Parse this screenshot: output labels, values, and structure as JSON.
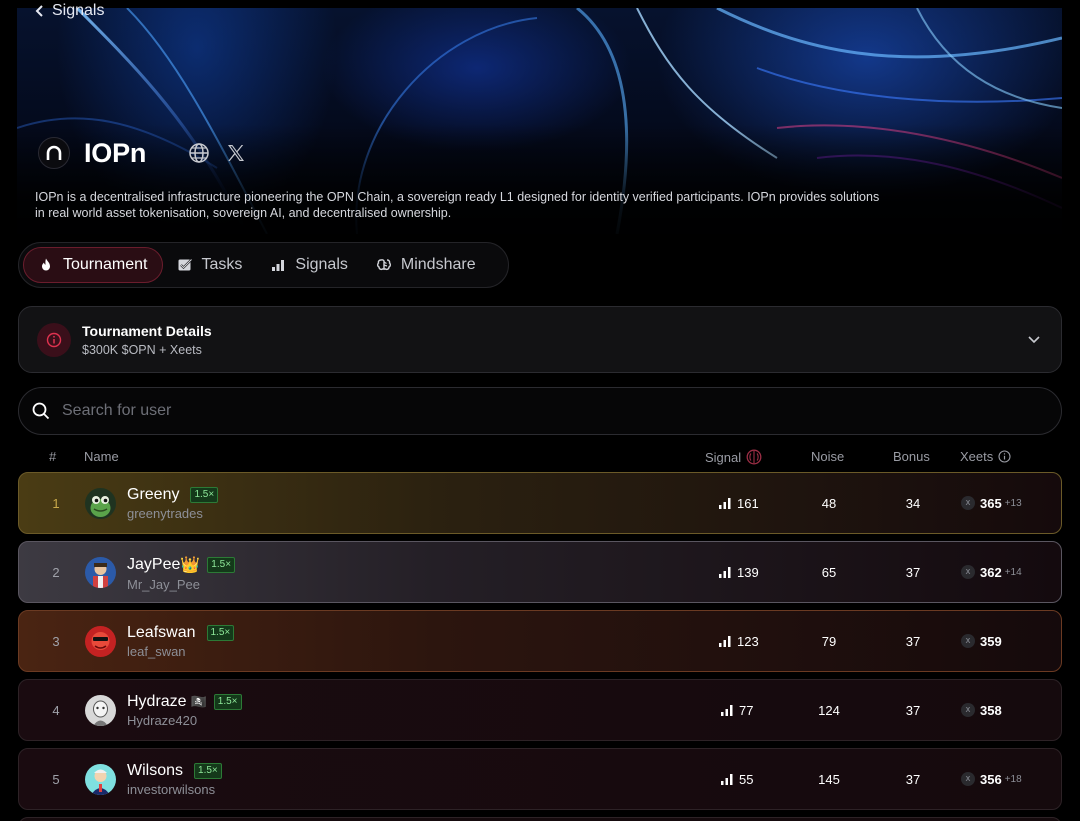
{
  "header": {
    "back_label": "Signals",
    "project_name": "IOPn",
    "description": "IOPn is a decentralised infrastructure pioneering the OPN Chain, a sovereign ready L1 designed for identity verified participants. IOPn provides solutions in real world asset tokenisation, sovereign AI, and decentralised ownership."
  },
  "tabs": [
    {
      "label": "Tournament",
      "icon": "flame-icon",
      "active": true
    },
    {
      "label": "Tasks",
      "icon": "checklist-icon",
      "active": false
    },
    {
      "label": "Signals",
      "icon": "bar-chart-icon",
      "active": false
    },
    {
      "label": "Mindshare",
      "icon": "brain-icon",
      "active": false
    }
  ],
  "tournament": {
    "title": "Tournament Details",
    "prize": "$300K $OPN + Xeets"
  },
  "search": {
    "placeholder": "Search for user"
  },
  "table": {
    "headers": {
      "rank": "#",
      "name": "Name",
      "signal": "Signal",
      "noise": "Noise",
      "bonus": "Bonus",
      "xeets": "Xeets"
    },
    "coin_label": "X",
    "rows": [
      {
        "rank": "1",
        "name": "Greeny",
        "badge": "",
        "multiplier": "1.5×",
        "handle": "greenytrades",
        "signal": "161",
        "noise": "48",
        "bonus": "34",
        "xeets": "365",
        "delta": "+13"
      },
      {
        "rank": "2",
        "name": "JayPee",
        "badge": "👑",
        "multiplier": "1.5×",
        "handle": "Mr_Jay_Pee",
        "signal": "139",
        "noise": "65",
        "bonus": "37",
        "xeets": "362",
        "delta": "+14"
      },
      {
        "rank": "3",
        "name": "Leafswan",
        "badge": "",
        "multiplier": "1.5×",
        "handle": "leaf_swan",
        "signal": "123",
        "noise": "79",
        "bonus": "37",
        "xeets": "359",
        "delta": ""
      },
      {
        "rank": "4",
        "name": "Hydraze",
        "badge": "🏴‍☠️",
        "multiplier": "1.5×",
        "handle": "Hydraze420",
        "signal": "77",
        "noise": "124",
        "bonus": "37",
        "xeets": "358",
        "delta": ""
      },
      {
        "rank": "5",
        "name": "Wilsons",
        "badge": "",
        "multiplier": "1.5×",
        "handle": "investorwilsons",
        "signal": "55",
        "noise": "145",
        "bonus": "37",
        "xeets": "356",
        "delta": "+18"
      }
    ]
  },
  "colors": {
    "accent": "#e0324f",
    "multiplier_green": "#8fe89a"
  }
}
